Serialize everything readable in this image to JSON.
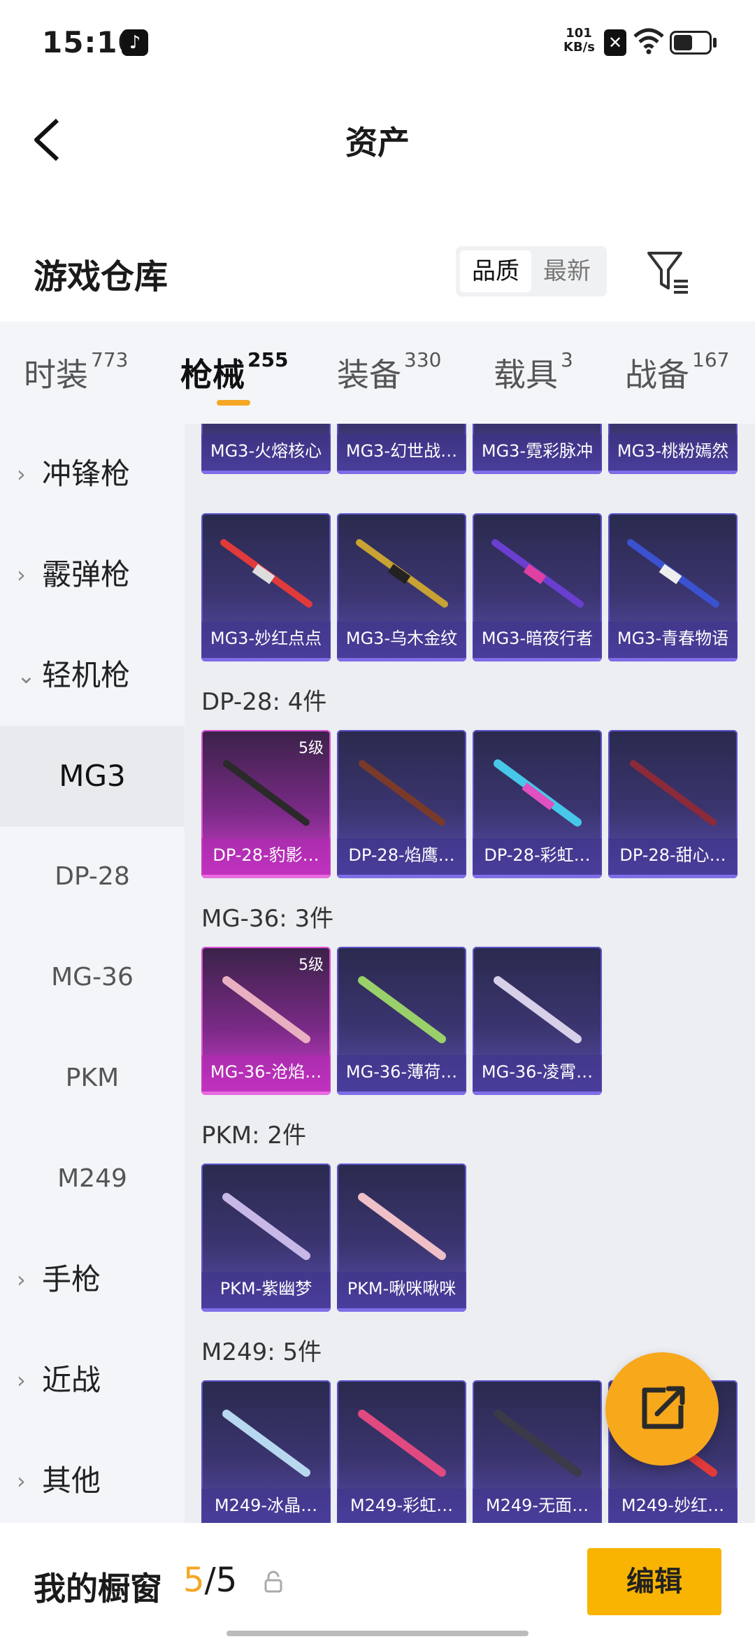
{
  "status_bar": {
    "time": "15:10",
    "net_speed_value": "101",
    "net_speed_unit": "KB/s",
    "battery_level": 0.55
  },
  "header": {
    "title": "资产"
  },
  "warehouse": {
    "title": "游戏仓库",
    "sort_options": [
      "品质",
      "最新"
    ],
    "sort_selected": "品质"
  },
  "category_tabs": [
    {
      "label": "时装",
      "count": "773"
    },
    {
      "label": "枪械",
      "count": "255",
      "active": true
    },
    {
      "label": "装备",
      "count": "330"
    },
    {
      "label": "载具",
      "count": "3"
    },
    {
      "label": "战备",
      "count": "167"
    }
  ],
  "sidebar": {
    "groups": [
      {
        "label": "冲锋枪",
        "chevron": "›"
      },
      {
        "label": "霰弹枪",
        "chevron": "›"
      },
      {
        "label": "轻机枪",
        "chevron": "⌄",
        "expanded": true
      },
      {
        "label": "手枪",
        "chevron": "›"
      },
      {
        "label": "近战",
        "chevron": "›"
      },
      {
        "label": "其他",
        "chevron": "›"
      }
    ],
    "sub_items": [
      "MG3",
      "DP-28",
      "MG-36",
      "PKM",
      "M249"
    ],
    "active_sub": "MG3"
  },
  "sections": {
    "mg3_row1": [
      "MG3-火熔核心",
      "MG3-幻世战…",
      "MG3-霓彩脉冲",
      "MG3-桃粉嫣然"
    ],
    "mg3_row2": [
      "MG3-妙红点点",
      "MG3-乌木金纹",
      "MG3-暗夜行者",
      "MG3-青春物语"
    ],
    "dp28": {
      "title": "DP-28: 4件",
      "items": [
        "DP-28-豹影…",
        "DP-28-焰鹰…",
        "DP-28-彩虹…",
        "DP-28-甜心…"
      ],
      "badge": "5级"
    },
    "mg36": {
      "title": "MG-36: 3件",
      "items": [
        "MG-36-沧焰…",
        "MG-36-薄荷…",
        "MG-36-凌霄…"
      ],
      "badge": "5级"
    },
    "pkm": {
      "title": "PKM: 2件",
      "items": [
        "PKM-紫幽梦",
        "PKM-啾咪啾咪"
      ]
    },
    "m249": {
      "title": "M249: 5件",
      "items": [
        "M249-冰晶…",
        "M249-彩虹…",
        "M249-无面…",
        "M249-妙红…"
      ]
    }
  },
  "showcase": {
    "label": "我的橱窗",
    "current": "5",
    "separator_total": "/5"
  },
  "buttons": {
    "edit": "编辑"
  },
  "colors": {
    "accent": "#f5a623",
    "edit_button": "#f8b400",
    "card_purple": "#3b3570",
    "card_gold": "#d43fd0"
  },
  "icons": [
    "tiktok-icon",
    "sim-icon",
    "wifi-icon",
    "battery-icon",
    "back-arrow-icon",
    "filter-icon",
    "chevron-icon",
    "share-export-icon",
    "lock-icon"
  ]
}
